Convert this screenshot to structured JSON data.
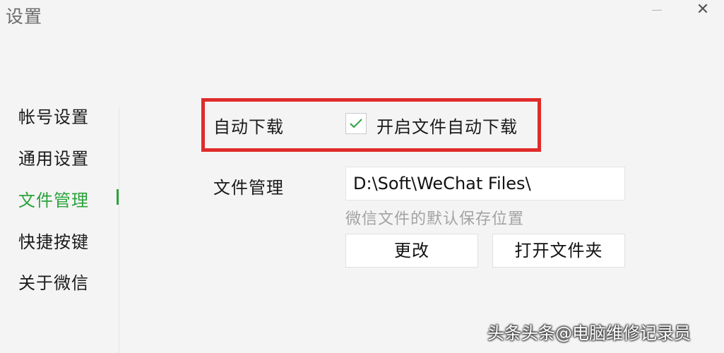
{
  "window": {
    "title": "设置",
    "close_glyph": "✕"
  },
  "sidebar": {
    "items": [
      {
        "label": "帐号设置",
        "active": false
      },
      {
        "label": "通用设置",
        "active": false
      },
      {
        "label": "文件管理",
        "active": true
      },
      {
        "label": "快捷按键",
        "active": false
      },
      {
        "label": "关于微信",
        "active": false
      }
    ]
  },
  "main": {
    "auto_download": {
      "label": "自动下载",
      "checkbox_label": "开启文件自动下载",
      "checked": true
    },
    "file_management": {
      "label": "文件管理",
      "path": "D:\\Soft\\WeChat Files\\",
      "hint": "微信文件的默认保存位置"
    },
    "buttons": {
      "change": "更改",
      "open_folder": "打开文件夹"
    }
  },
  "watermark": "头条头条@电脑维修记录员",
  "colors": {
    "accent_green": "#2aa33b",
    "highlight_red": "#e02b2b",
    "background": "#f4f4f4"
  }
}
